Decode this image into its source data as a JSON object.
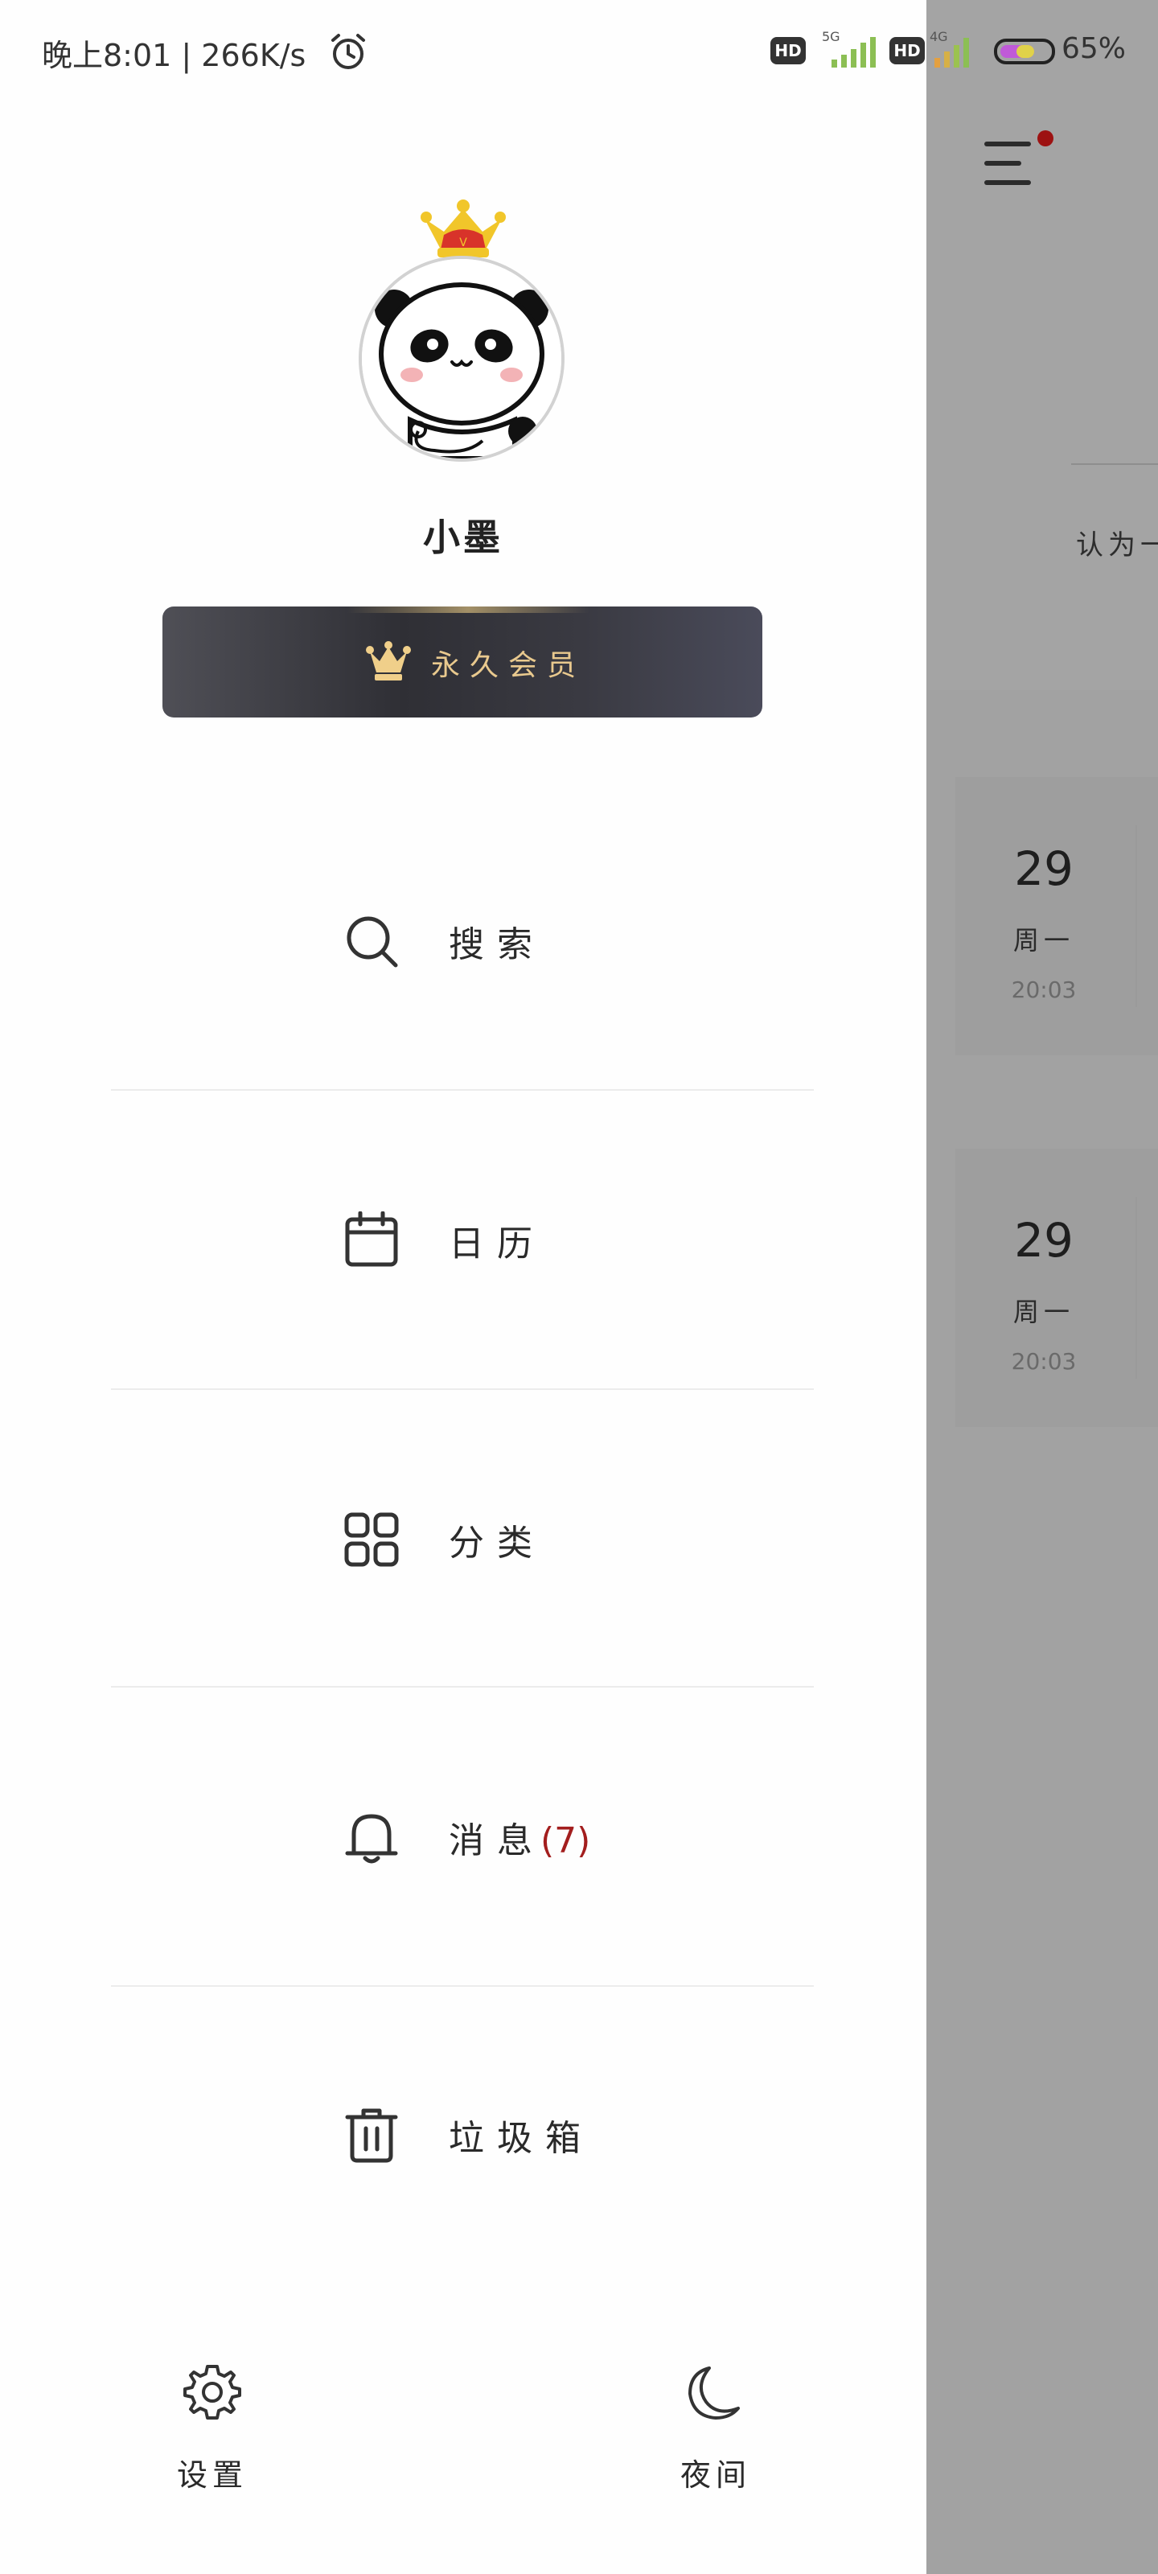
{
  "status_bar": {
    "time_and_speed": "晚上8:01 | 266K/s",
    "network_1": "5G",
    "network_2": "4G",
    "hd_1": "HD",
    "hd_2": "HD",
    "battery": "65%"
  },
  "profile": {
    "username": "小墨",
    "vip_label": "永久会员"
  },
  "menu": {
    "items": [
      {
        "label": "搜索",
        "icon": "search-icon"
      },
      {
        "label": "日历",
        "icon": "calendar-icon"
      },
      {
        "label": "分类",
        "icon": "grid-icon"
      },
      {
        "label": "消息",
        "count": "(7)",
        "icon": "bell-icon"
      },
      {
        "label": "垃圾箱",
        "icon": "trash-icon"
      }
    ]
  },
  "bottom": {
    "settings": "设置",
    "night": "夜间"
  },
  "background_page": {
    "snippet": "认为一",
    "cards": [
      {
        "day": "29",
        "weekday": "周一",
        "time": "20:03"
      },
      {
        "day": "29",
        "weekday": "周一",
        "time": "20:03"
      }
    ]
  },
  "colors": {
    "accent_red": "#a31e1e",
    "vip_gold": "#e9c98e",
    "overlay_gray": "#a3a3a3"
  }
}
